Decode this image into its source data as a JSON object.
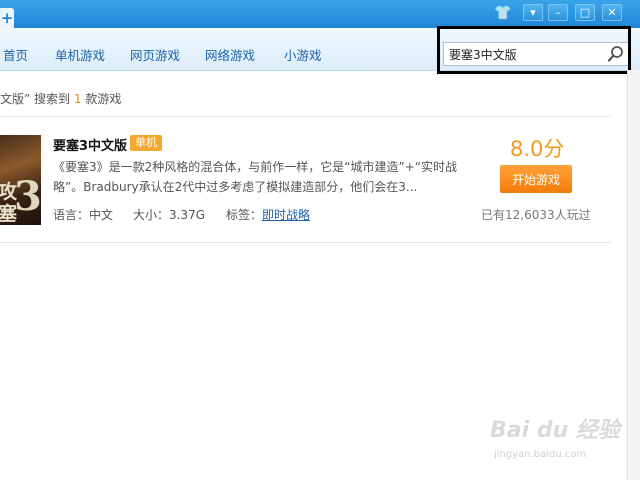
{
  "window": {
    "add_tab_glyph": "+",
    "controls": {
      "skin": "👕",
      "menu": "▾",
      "minimize": "–",
      "maximize": "□",
      "close": "✕"
    }
  },
  "nav": {
    "items": [
      "首页",
      "单机游戏",
      "网页游戏",
      "网络游戏",
      "小游戏"
    ]
  },
  "search": {
    "value": "要塞3中文版",
    "placeholder": ""
  },
  "summary": {
    "prefix": "文版” 搜索到",
    "count": "1",
    "suffix": "款游戏"
  },
  "result": {
    "cover_text": "攻\n塞",
    "cover_num": "3",
    "title": "要塞3中文版",
    "badge": "单机",
    "description": "《要塞3》是一款2种风格的混合体，与前作一样，它是“城市建造”+“实时战略”。Bradbury承认在2代中过多考虑了模拟建造部分，他们会在3...",
    "language": "语言：中文",
    "size": "大小：3.37G",
    "tag_label": "标签：",
    "tag": "即时战略",
    "score": "8.0分",
    "play_label": "开始游戏",
    "played": "已有12,6033人玩过"
  },
  "watermark": {
    "main": "Bai du 经验",
    "sub": "jingyan.baidu.com"
  },
  "colors": {
    "accent": "#1f86d6",
    "score": "#f39a1d",
    "button": "#f27c0a",
    "link": "#1b63a8"
  }
}
